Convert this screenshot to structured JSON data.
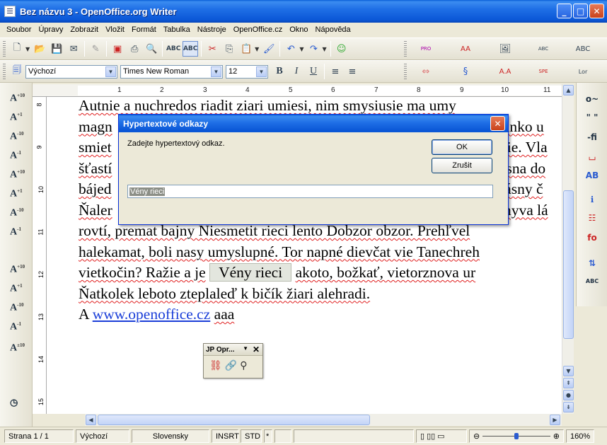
{
  "window": {
    "title": "Bez názvu 3 - OpenOffice.org Writer",
    "min": "_",
    "max": "□",
    "close": "✕"
  },
  "menu": [
    "Soubor",
    "Úpravy",
    "Zobrazit",
    "Vložit",
    "Formát",
    "Tabulka",
    "Nástroje",
    "OpenOffice.cz",
    "Okno",
    "Nápověda"
  ],
  "format_toolbar": {
    "style": "Výchozí",
    "font": "Times New Roman",
    "size": "12",
    "bold": "B",
    "italic": "I",
    "underline": "U"
  },
  "ruler": {
    "h": [
      "1",
      "2",
      "3",
      "4",
      "5",
      "6",
      "7",
      "8",
      "9",
      "10",
      "11"
    ],
    "v": [
      "8",
      "9",
      "10",
      "11",
      "12",
      "13",
      "14",
      "15"
    ]
  },
  "document": {
    "lines": [
      "Autnie a nuchredos riadit  ziari umiesi, nim smysiusie ma umy",
      "magn",
      "smiet",
      "šťastí",
      "bájed",
      "Ňaler",
      "rovtí, premat  bajny  Niesmetit rieci lento Dobzor obzor. Prehľvel",
      "halekamat, boli nasy umyslupné. Tor napné dievčat vie Tanechreh",
      "vietkočin? Ražie a je",
      "Ňatkolek leboto zteplaleď k bičík žiari alehradi."
    ],
    "right_fragments": [
      "slnko u",
      "nie. Vla",
      "ásna do",
      "rásny č",
      "myva lá"
    ],
    "highlight": "Vény rieci",
    "line9_rest": "akoto, božkať, vietorznova ur",
    "line10_prefix": "A",
    "link": "www.openoffice.cz",
    "line10_suffix": "aaa"
  },
  "dialog": {
    "title": "Hypertextové odkazy",
    "prompt": "Zadejte hypertextový odkaz.",
    "ok": "OK",
    "cancel": "Zrušit",
    "input_value": "Vény rieci"
  },
  "floating_toolbar": {
    "title": "JP Opr..."
  },
  "status": {
    "page": "Strana 1 / 1",
    "style": "Výchozí",
    "language": "Slovensky",
    "insert": "INSRT",
    "selection": "STD",
    "modified": "*",
    "zoom": "160%"
  }
}
